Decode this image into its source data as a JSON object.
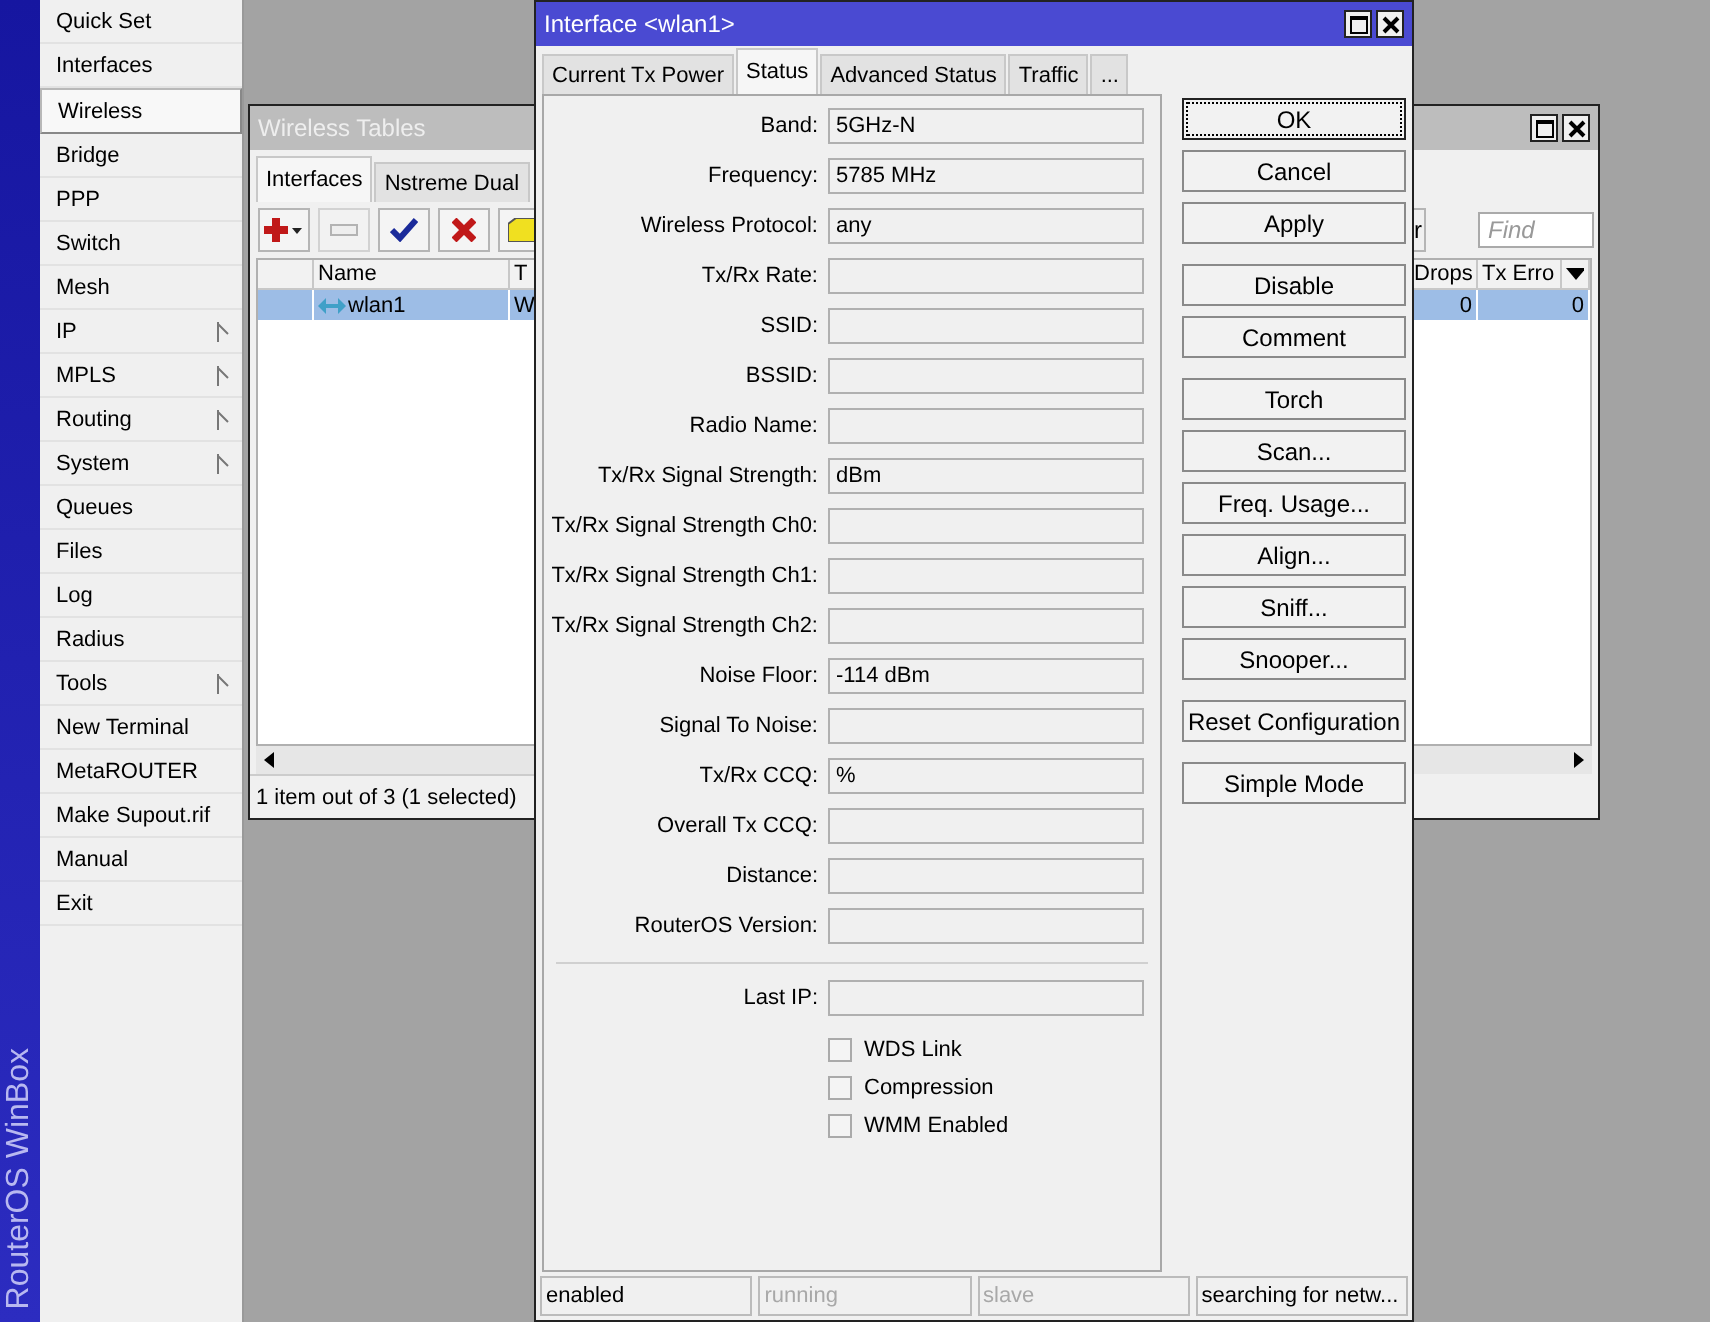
{
  "sidebar": {
    "brand": "RouterOS WinBox",
    "items": [
      {
        "label": "Quick Set",
        "selected": false,
        "submenu": false
      },
      {
        "label": "Interfaces",
        "selected": false,
        "submenu": false
      },
      {
        "label": "Wireless",
        "selected": true,
        "submenu": false
      },
      {
        "label": "Bridge",
        "selected": false,
        "submenu": false
      },
      {
        "label": "PPP",
        "selected": false,
        "submenu": false
      },
      {
        "label": "Switch",
        "selected": false,
        "submenu": false
      },
      {
        "label": "Mesh",
        "selected": false,
        "submenu": false
      },
      {
        "label": "IP",
        "selected": false,
        "submenu": true
      },
      {
        "label": "MPLS",
        "selected": false,
        "submenu": true
      },
      {
        "label": "Routing",
        "selected": false,
        "submenu": true
      },
      {
        "label": "System",
        "selected": false,
        "submenu": true
      },
      {
        "label": "Queues",
        "selected": false,
        "submenu": false
      },
      {
        "label": "Files",
        "selected": false,
        "submenu": false
      },
      {
        "label": "Log",
        "selected": false,
        "submenu": false
      },
      {
        "label": "Radius",
        "selected": false,
        "submenu": false
      },
      {
        "label": "Tools",
        "selected": false,
        "submenu": true
      },
      {
        "label": "New Terminal",
        "selected": false,
        "submenu": false
      },
      {
        "label": "MetaROUTER",
        "selected": false,
        "submenu": false
      },
      {
        "label": "Make Supout.rif",
        "selected": false,
        "submenu": false
      },
      {
        "label": "Manual",
        "selected": false,
        "submenu": false
      },
      {
        "label": "Exit",
        "selected": false,
        "submenu": false
      }
    ]
  },
  "wireless_window": {
    "title": "Wireless Tables",
    "tabs": [
      {
        "label": "Interfaces",
        "selected": true
      },
      {
        "label": "Nstreme Dual",
        "selected": false
      }
    ],
    "toolbar": [
      {
        "kind": "add",
        "disabled": false
      },
      {
        "kind": "remove",
        "disabled": true
      },
      {
        "kind": "enable",
        "disabled": false
      },
      {
        "kind": "disable",
        "disabled": false
      },
      {
        "kind": "comment",
        "disabled": false
      }
    ],
    "toolbar_right_button": "r",
    "find": {
      "placeholder": "Find"
    },
    "columns_left": [
      "Name",
      "T"
    ],
    "columns_right": [
      "Drops",
      "Tx Erro"
    ],
    "rows": [
      {
        "name": "wlan1",
        "column_2": "W",
        "drops": "0",
        "tx_errors": "0",
        "selected": true
      }
    ],
    "status": "1 item out of 3 (1 selected)"
  },
  "dialog": {
    "title": "Interface <wlan1>",
    "tabs": [
      {
        "label": "Current Tx Power",
        "selected": false
      },
      {
        "label": "Status",
        "selected": true
      },
      {
        "label": "Advanced Status",
        "selected": false
      },
      {
        "label": "Traffic",
        "selected": false
      },
      {
        "label": "...",
        "selected": false
      }
    ],
    "fields": [
      {
        "label": "Band:",
        "value": "5GHz-N"
      },
      {
        "label": "Frequency:",
        "value": "5785 MHz"
      },
      {
        "label": "Wireless Protocol:",
        "value": "any"
      },
      {
        "label": "Tx/Rx Rate:"
      },
      {
        "label": "SSID:"
      },
      {
        "label": "BSSID:"
      },
      {
        "label": "Radio Name:"
      },
      {
        "label": "Tx/Rx Signal Strength:",
        "value": "dBm"
      },
      {
        "label": "Tx/Rx Signal Strength Ch0:"
      },
      {
        "label": "Tx/Rx Signal Strength Ch1:"
      },
      {
        "label": "Tx/Rx Signal Strength Ch2:"
      },
      {
        "label": "Noise Floor:",
        "value": "-114 dBm"
      },
      {
        "label": "Signal To Noise:"
      },
      {
        "label": "Tx/Rx CCQ:",
        "value": "%"
      },
      {
        "label": "Overall Tx CCQ:"
      },
      {
        "label": "Distance:"
      },
      {
        "label": "RouterOS Version:"
      }
    ],
    "last_ip": {
      "label": "Last IP:"
    },
    "checkboxes": [
      {
        "label": "WDS Link",
        "checked": false
      },
      {
        "label": "Compression",
        "checked": false
      },
      {
        "label": "WMM Enabled",
        "checked": false
      }
    ],
    "button_groups": [
      [
        {
          "label": "OK",
          "focused": true
        },
        {
          "label": "Cancel",
          "focused": false
        },
        {
          "label": "Apply",
          "focused": false
        }
      ],
      [
        {
          "label": "Disable",
          "focused": false
        },
        {
          "label": "Comment",
          "focused": false
        }
      ],
      [
        {
          "label": "Torch",
          "focused": false
        },
        {
          "label": "Scan...",
          "focused": false
        },
        {
          "label": "Freq. Usage...",
          "focused": false
        },
        {
          "label": "Align...",
          "focused": false
        },
        {
          "label": "Sniff...",
          "focused": false
        },
        {
          "label": "Snooper...",
          "focused": false
        }
      ],
      [
        {
          "label": "Reset Configuration",
          "focused": false
        }
      ],
      [
        {
          "label": "Simple Mode",
          "focused": false
        }
      ]
    ],
    "status_bar": [
      {
        "text": "enabled",
        "disabled": false
      },
      {
        "text": "running",
        "disabled": true
      },
      {
        "text": "slave",
        "disabled": true
      },
      {
        "text": "searching for netw...",
        "disabled": false
      }
    ]
  }
}
